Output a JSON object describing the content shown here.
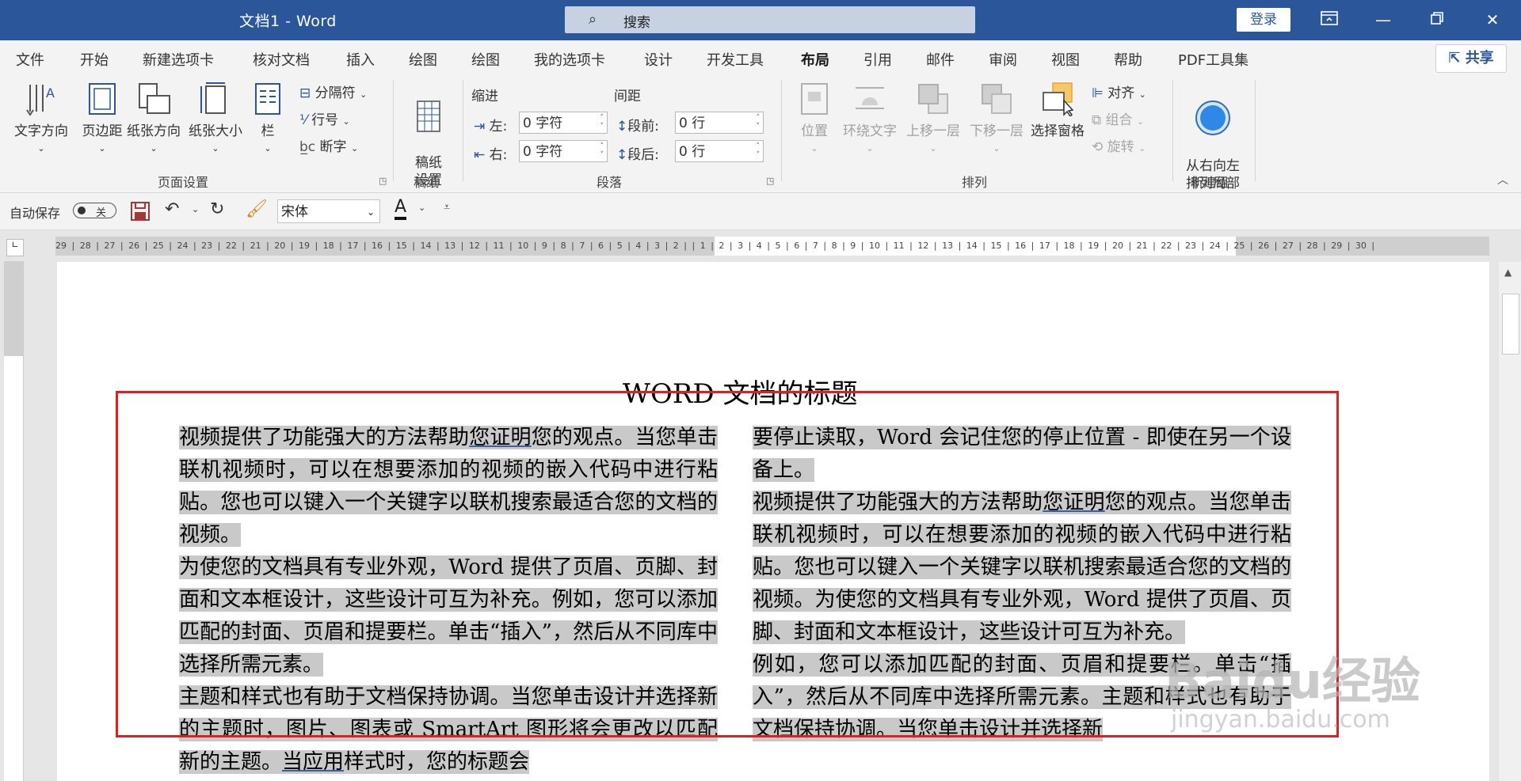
{
  "titlebar": {
    "title": "文档1  -  Word",
    "search_placeholder": "搜索",
    "login": "登录"
  },
  "menu": {
    "tabs": [
      "文件",
      "开始",
      "新建选项卡",
      "核对文档",
      "插入",
      "绘图",
      "绘图",
      "我的选项卡",
      "设计",
      "开发工具",
      "布局",
      "引用",
      "邮件",
      "审阅",
      "视图",
      "帮助",
      "PDF工具集"
    ],
    "active": "布局",
    "share": "共享"
  },
  "ribbon": {
    "page_setup": {
      "text_direction": "文字方向",
      "margins": "页边距",
      "orientation": "纸张方向",
      "size": "纸张大小",
      "columns": "栏",
      "breaks": "分隔符",
      "line_numbers": "行号",
      "hyphenation": "断字",
      "label": "页面设置"
    },
    "draft": {
      "button": "稿纸\n设置",
      "label": "稿纸"
    },
    "paragraph": {
      "indent_title": "缩进",
      "spacing_title": "间距",
      "left_label": "左:",
      "left_value": "0 字符",
      "right_label": "右:",
      "right_value": "0 字符",
      "before_label": "段前:",
      "before_value": "0 行",
      "after_label": "段后:",
      "after_value": "0 行",
      "label": "段落"
    },
    "arrange": {
      "position": "位置",
      "wrap": "环绕文字",
      "bring_forward": "上移一层",
      "send_backward": "下移一层",
      "selection_pane": "选择窗格",
      "align": "对齐",
      "group": "组合",
      "rotate": "旋转",
      "label": "排列"
    },
    "new_group": {
      "button": "从右向左\n排列局部",
      "label": "新建组"
    }
  },
  "qat": {
    "autosave": "自动保存",
    "autosave_state": "关",
    "font": "宋体"
  },
  "ruler": {
    "numbers": "29 | 28 | 27 | 26 | 25 | 24 | 23 | 22 | 21 | 20 | 19 | 18 | 17 | 16 | 15 | 14 | 13 | 12 | 11 | 10 | 9 | 8 | 7 | 6 | 5 | 4 | 3 | 2 |    | 1 | 2 | 3 | 4 | 5 | 6 | 7 | 8 | 9 | 10 | 11 | 12 | 13 | 14 | 15 | 16 | 17 | 18 | 19 | 20 | 21 | 22 | 23 | 24 | 25 | 26 | 27 | 28 | 29 | 30 |"
  },
  "document": {
    "title": "WORD 文档的标题",
    "left_column": {
      "p1_a": "视频提供了功能强大的方法帮助",
      "p1_link": "您证明",
      "p1_b": "您的观点。当您单击联机视频时，可以在想要添加的视频的嵌入代码中进行粘贴。您也可以键入一个关键字以联机搜索最适合您的文档的视频。",
      "p2": "为使您的文档具有专业外观，Word 提供了页眉、页脚、封面和文本框设计，这些设计可互为补充。例如，您可以添加匹配的封面、页眉和提要栏。单击“插入”，然后从不同库中选择所需元素。",
      "p3_a": "主题和样式也有助于文档保持协调。当您单击设计并选择新的主题时，图片、图表或 SmartArt 图形将会更改以匹配新的主题。",
      "p3_link": "当应用",
      "p3_b": "样式时，您的标题会"
    },
    "right_column": {
      "p1": "要停止读取，Word 会记住您的停止位置 - 即使在另一个设备上。",
      "p2_a": "视频提供了功能强大的方法帮助",
      "p2_link": "您证明",
      "p2_b": "您的观点。当您单击联机视频时，可以在想要添加的视频的嵌入代码中进行粘贴。您也可以键入一个关键字以联机搜索最适合您的文档的视频。为使您的文档具有专业外观，Word 提供了页眉、页脚、封面和文本框设计，这些设计可互为补充。",
      "p3": "例如，您可以添加匹配的封面、页眉和提要栏。单击“插入”，然后从不同库中选择所需元素。主题和样式也有助于文档保持协调。当您单击设计并选择新"
    }
  },
  "watermark": {
    "brand": "Baidu经验",
    "url": "jingyan.baidu.com"
  }
}
